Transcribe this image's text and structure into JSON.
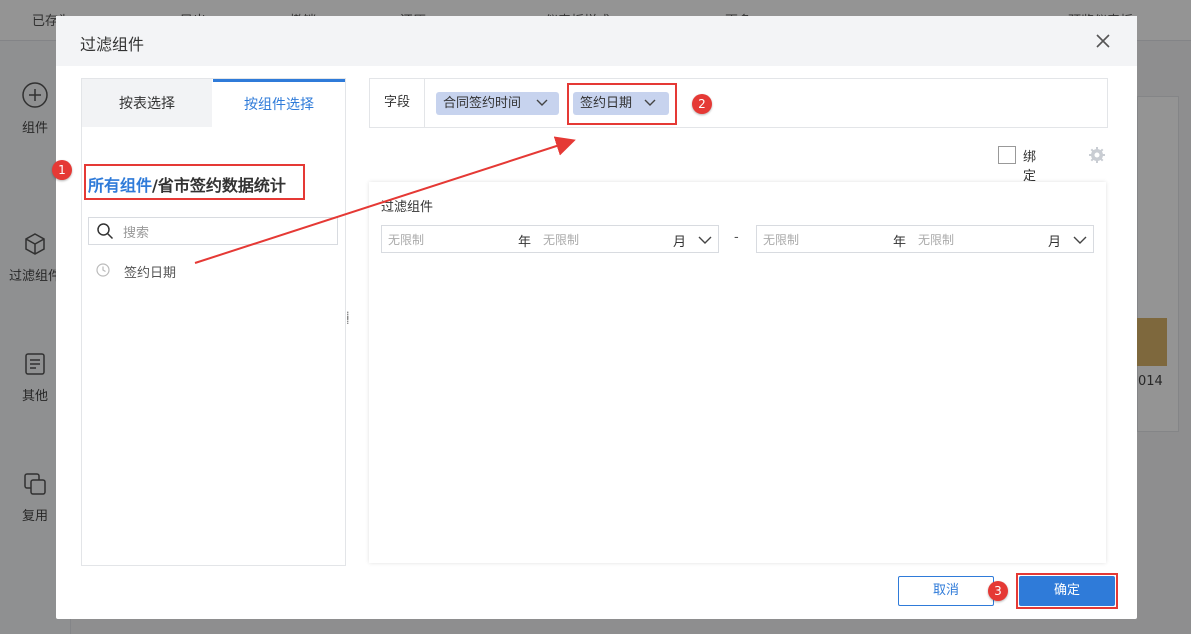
{
  "app": {
    "toolbar": [
      "已存为",
      "导出",
      "撤销",
      "还原",
      "仪表板样式",
      "更多",
      "预览仪表板"
    ],
    "sidebar": [
      {
        "label": "组件",
        "icon": "plus-circle-icon"
      },
      {
        "label": "过滤组件",
        "icon": "cube-icon"
      },
      {
        "label": "其他",
        "icon": "document-icon"
      },
      {
        "label": "复用",
        "icon": "copy-icon"
      }
    ],
    "bg_axis_label": "014"
  },
  "dialog": {
    "title": "过滤组件",
    "close_icon": "close-icon",
    "left": {
      "tabs": [
        {
          "label": "按表选择",
          "active": false
        },
        {
          "label": "按组件选择",
          "active": true
        }
      ],
      "breadcrumb": {
        "root": "所有组件",
        "separator": "/",
        "current": "省市签约数据统计"
      },
      "search_placeholder": "搜索",
      "items": [
        {
          "label": "签约日期",
          "icon": "clock-icon"
        }
      ]
    },
    "field_row": {
      "label": "字段",
      "tags": [
        {
          "label": "合同签约时间"
        },
        {
          "label": "签约日期"
        }
      ]
    },
    "bind_param": {
      "label": "绑定参数",
      "checked": false
    },
    "preview": {
      "title": "过滤组件",
      "from": {
        "year_value": "无限制",
        "year_unit": "年",
        "month_value": "无限制",
        "month_unit": "月"
      },
      "separator": "-",
      "to": {
        "year_value": "无限制",
        "year_unit": "年",
        "month_value": "无限制",
        "month_unit": "月"
      }
    },
    "buttons": {
      "cancel": "取消",
      "ok": "确定"
    }
  },
  "annotations": {
    "step1": "1",
    "step2": "2",
    "step3": "3"
  },
  "colors": {
    "accent": "#2f7bd9",
    "highlight": "#e53935",
    "tag_bg": "#c7d3ee"
  }
}
